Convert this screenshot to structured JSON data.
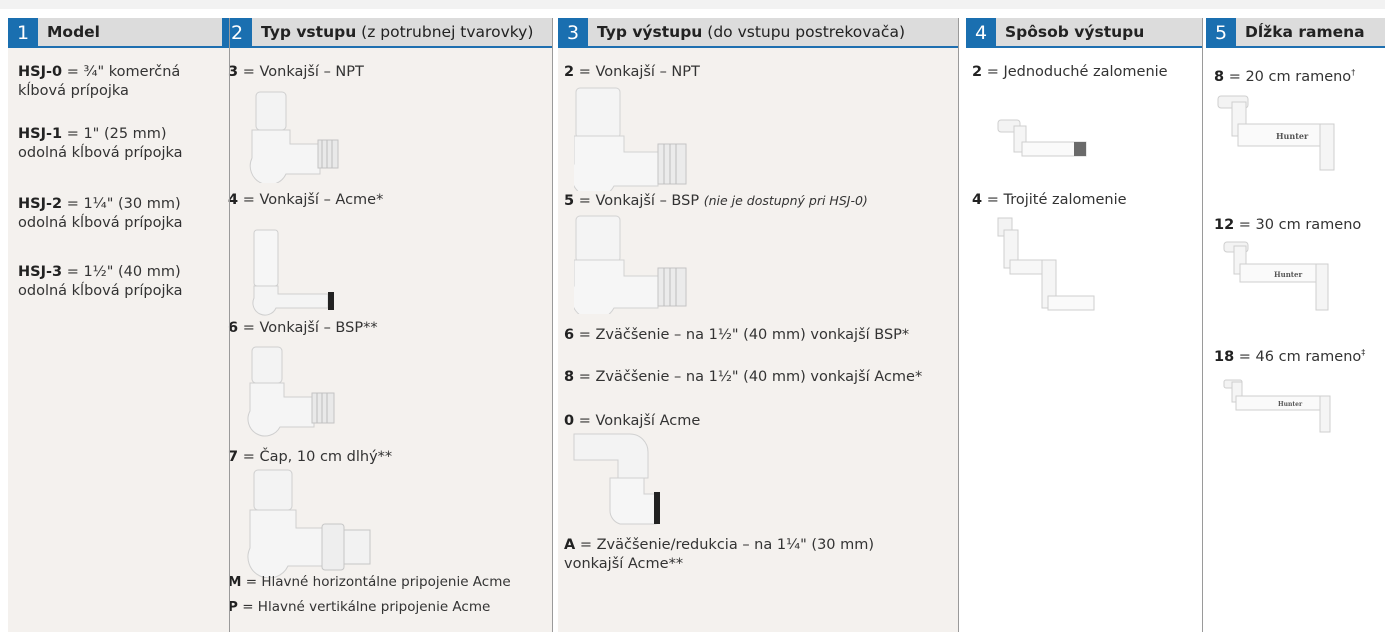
{
  "columns": [
    {
      "number": "1",
      "title": "Model",
      "subtitle": "",
      "items": [
        {
          "code": "HSJ-0",
          "line1": " = ¾\" komerčná",
          "line2": "kĺbová prípojka"
        },
        {
          "code": "HSJ-1",
          "line1": " = 1\" (25 mm)",
          "line2": "odolná kĺbová prípojka"
        },
        {
          "code": "HSJ-2",
          "line1": " = 1¼\" (30 mm)",
          "line2": "odolná kĺbová prípojka"
        },
        {
          "code": "HSJ-3",
          "line1": " = 1½\" (40 mm)",
          "line2": "odolná kĺbová prípojka"
        }
      ]
    },
    {
      "number": "2",
      "title": "Typ vstupu",
      "subtitle": " (z potrubnej tvarovky)",
      "items": [
        {
          "code": "3",
          "text": " = Vonkajší – NPT"
        },
        {
          "code": "4",
          "text": " = Vonkajší – Acme*"
        },
        {
          "code": "6",
          "text": " = Vonkajší – BSP**"
        },
        {
          "code": "7",
          "text": " = Čap, 10 cm dlhý**"
        },
        {
          "code": "M",
          "text": " = Hlavné horizontálne pripojenie Acme"
        },
        {
          "code": "P",
          "text": " = Hlavné vertikálne pripojenie Acme"
        }
      ]
    },
    {
      "number": "3",
      "title": "Typ výstupu",
      "subtitle": " (do vstupu postrekovača)",
      "items": [
        {
          "code": "2",
          "text": " = Vonkajší – NPT"
        },
        {
          "code": "5",
          "text": " = Vonkajší – BSP ",
          "note": "(nie je dostupný pri HSJ-0)"
        },
        {
          "code": "6",
          "text": " = Zväčšenie – na 1½\" (40 mm) vonkajší BSP*"
        },
        {
          "code": "8",
          "text": " = Zväčšenie – na 1½\" (40 mm) vonkajší Acme*"
        },
        {
          "code": "0",
          "text": " = Vonkajší Acme"
        },
        {
          "code": "A",
          "text": " = Zväčšenie/redukcia – na 1¼\" (30 mm)",
          "line2": "vonkajší Acme**"
        }
      ]
    },
    {
      "number": "4",
      "title": "Spôsob výstupu",
      "subtitle": "",
      "items": [
        {
          "code": "2",
          "text": " = Jednoduché zalomenie"
        },
        {
          "code": "4",
          "text": " = Trojité zalomenie"
        }
      ]
    },
    {
      "number": "5",
      "title": "Dĺžka ramena",
      "subtitle": "",
      "items": [
        {
          "code": "8",
          "text": " = 20 cm rameno",
          "mark": "†"
        },
        {
          "code": "12",
          "text": " = 30 cm rameno",
          "mark": ""
        },
        {
          "code": "18",
          "text": " = 46 cm rameno",
          "mark": "‡"
        }
      ]
    }
  ],
  "brand_label": "Hunter",
  "colors": {
    "accent": "#1a6fb0",
    "header_bg": "#dcdcdc",
    "shaded_bg": "#f4f1ee"
  }
}
